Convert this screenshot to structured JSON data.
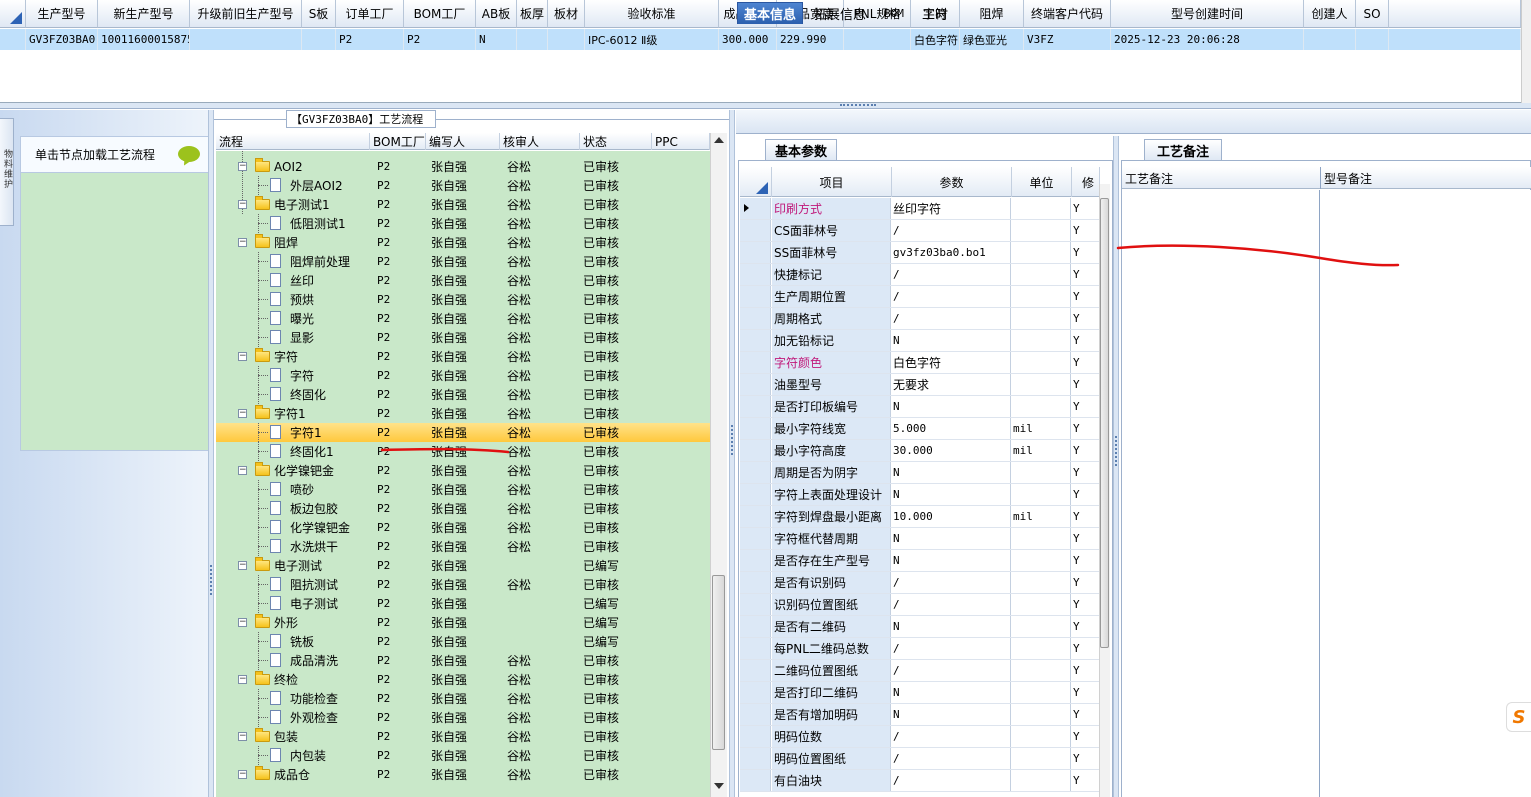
{
  "top_grid": {
    "columns": [
      "生产型号",
      "新生产型号",
      "升级前旧生产型号",
      "S板",
      "订单工厂",
      "BOM工厂",
      "AB板",
      "板厚",
      "板材",
      "验收标准",
      "成品长度",
      "成品宽度",
      "PNL规格",
      "字符",
      "阻焊",
      "终端客户代码",
      "型号创建时间",
      "创建人",
      "SO"
    ],
    "row": [
      "GV3FZ03BA0",
      "10011600015875",
      "",
      "",
      "P2",
      "P2",
      "N",
      "",
      "",
      "IPC-6012 Ⅱ级",
      "300.000",
      "229.990",
      "",
      "白色字符",
      "绿色亚光",
      "V3FZ",
      "2025-12-23 20:06:28",
      "",
      ""
    ]
  },
  "left_panel": {
    "side_tab": "物料维护",
    "hint": "单击节点加载工艺流程"
  },
  "process_panel": {
    "title": "【GV3FZ03BA0】工艺流程",
    "columns": [
      "流程",
      "BOM工厂",
      "编写人",
      "核审人",
      "状态",
      "PPC"
    ],
    "rows": [
      {
        "level": 1,
        "name": "AOI2",
        "bom": "P2",
        "writer": "张自强",
        "reviewer": "谷松",
        "status": "已审核"
      },
      {
        "level": 2,
        "name": "外层AOI2",
        "bom": "P2",
        "writer": "张自强",
        "reviewer": "谷松",
        "status": "已审核"
      },
      {
        "level": 1,
        "name": "电子测试1",
        "bom": "P2",
        "writer": "张自强",
        "reviewer": "谷松",
        "status": "已审核"
      },
      {
        "level": 2,
        "name": "低阻测试1",
        "bom": "P2",
        "writer": "张自强",
        "reviewer": "谷松",
        "status": "已审核"
      },
      {
        "level": 1,
        "name": "阻焊",
        "bom": "P2",
        "writer": "张自强",
        "reviewer": "谷松",
        "status": "已审核"
      },
      {
        "level": 2,
        "name": "阻焊前处理",
        "bom": "P2",
        "writer": "张自强",
        "reviewer": "谷松",
        "status": "已审核"
      },
      {
        "level": 2,
        "name": "丝印",
        "bom": "P2",
        "writer": "张自强",
        "reviewer": "谷松",
        "status": "已审核"
      },
      {
        "level": 2,
        "name": "预烘",
        "bom": "P2",
        "writer": "张自强",
        "reviewer": "谷松",
        "status": "已审核"
      },
      {
        "level": 2,
        "name": "曝光",
        "bom": "P2",
        "writer": "张自强",
        "reviewer": "谷松",
        "status": "已审核"
      },
      {
        "level": 2,
        "name": "显影",
        "bom": "P2",
        "writer": "张自强",
        "reviewer": "谷松",
        "status": "已审核"
      },
      {
        "level": 1,
        "name": "字符",
        "bom": "P2",
        "writer": "张自强",
        "reviewer": "谷松",
        "status": "已审核"
      },
      {
        "level": 2,
        "name": "字符",
        "bom": "P2",
        "writer": "张自强",
        "reviewer": "谷松",
        "status": "已审核"
      },
      {
        "level": 2,
        "name": "终固化",
        "bom": "P2",
        "writer": "张自强",
        "reviewer": "谷松",
        "status": "已审核"
      },
      {
        "level": 1,
        "name": "字符1",
        "bom": "P2",
        "writer": "张自强",
        "reviewer": "谷松",
        "status": "已审核"
      },
      {
        "level": 2,
        "name": "字符1",
        "bom": "P2",
        "writer": "张自强",
        "reviewer": "谷松",
        "status": "已审核",
        "selected": true
      },
      {
        "level": 2,
        "name": "终固化1",
        "bom": "P2",
        "writer": "张自强",
        "reviewer": "谷松",
        "status": "已审核"
      },
      {
        "level": 1,
        "name": "化学镍钯金",
        "bom": "P2",
        "writer": "张自强",
        "reviewer": "谷松",
        "status": "已审核"
      },
      {
        "level": 2,
        "name": "喷砂",
        "bom": "P2",
        "writer": "张自强",
        "reviewer": "谷松",
        "status": "已审核"
      },
      {
        "level": 2,
        "name": "板边包胶",
        "bom": "P2",
        "writer": "张自强",
        "reviewer": "谷松",
        "status": "已审核"
      },
      {
        "level": 2,
        "name": "化学镍钯金",
        "bom": "P2",
        "writer": "张自强",
        "reviewer": "谷松",
        "status": "已审核"
      },
      {
        "level": 2,
        "name": "水洗烘干",
        "bom": "P2",
        "writer": "张自强",
        "reviewer": "谷松",
        "status": "已审核"
      },
      {
        "level": 1,
        "name": "电子测试",
        "bom": "P2",
        "writer": "张自强",
        "reviewer": "",
        "status": "已编写"
      },
      {
        "level": 2,
        "name": "阻抗测试",
        "bom": "P2",
        "writer": "张自强",
        "reviewer": "谷松",
        "status": "已审核"
      },
      {
        "level": 2,
        "name": "电子测试",
        "bom": "P2",
        "writer": "张自强",
        "reviewer": "",
        "status": "已编写"
      },
      {
        "level": 1,
        "name": "外形",
        "bom": "P2",
        "writer": "张自强",
        "reviewer": "",
        "status": "已编写"
      },
      {
        "level": 2,
        "name": "铣板",
        "bom": "P2",
        "writer": "张自强",
        "reviewer": "",
        "status": "已编写"
      },
      {
        "level": 2,
        "name": "成品清洗",
        "bom": "P2",
        "writer": "张自强",
        "reviewer": "谷松",
        "status": "已审核"
      },
      {
        "level": 1,
        "name": "终检",
        "bom": "P2",
        "writer": "张自强",
        "reviewer": "谷松",
        "status": "已审核"
      },
      {
        "level": 2,
        "name": "功能检查",
        "bom": "P2",
        "writer": "张自强",
        "reviewer": "谷松",
        "status": "已审核"
      },
      {
        "level": 2,
        "name": "外观检查",
        "bom": "P2",
        "writer": "张自强",
        "reviewer": "谷松",
        "status": "已审核"
      },
      {
        "level": 1,
        "name": "包装",
        "bom": "P2",
        "writer": "张自强",
        "reviewer": "谷松",
        "status": "已审核"
      },
      {
        "level": 2,
        "name": "内包装",
        "bom": "P2",
        "writer": "张自强",
        "reviewer": "谷松",
        "status": "已审核"
      },
      {
        "level": 1,
        "name": "成品仓",
        "bom": "P2",
        "writer": "张自强",
        "reviewer": "谷松",
        "status": "已审核"
      }
    ]
  },
  "right_tabs": [
    "基本信息",
    "拓展信息",
    "BOM",
    "工时"
  ],
  "basic_params": {
    "tab": "基本参数",
    "columns": [
      "项目",
      "参数",
      "单位",
      "修"
    ],
    "rows": [
      {
        "item": "印刷方式",
        "value": "丝印字符",
        "unit": "",
        "flag": "Y",
        "pink": true,
        "current": true
      },
      {
        "item": "CS面菲林号",
        "value": "/",
        "unit": "",
        "flag": "Y"
      },
      {
        "item": "SS面菲林号",
        "value": "gv3fz03ba0.bo1",
        "unit": "",
        "flag": "Y"
      },
      {
        "item": "快捷标记",
        "value": "/",
        "unit": "",
        "flag": "Y"
      },
      {
        "item": "生产周期位置",
        "value": "/",
        "unit": "",
        "flag": "Y"
      },
      {
        "item": "周期格式",
        "value": "/",
        "unit": "",
        "flag": "Y"
      },
      {
        "item": "加无铅标记",
        "value": "N",
        "unit": "",
        "flag": "Y"
      },
      {
        "item": "字符颜色",
        "value": "白色字符",
        "unit": "",
        "flag": "Y",
        "pink": true
      },
      {
        "item": "油墨型号",
        "value": "无要求",
        "unit": "",
        "flag": "Y"
      },
      {
        "item": "是否打印板编号",
        "value": "N",
        "unit": "",
        "flag": "Y"
      },
      {
        "item": "最小字符线宽",
        "value": "5.000",
        "unit": "mil",
        "flag": "Y"
      },
      {
        "item": "最小字符高度",
        "value": "30.000",
        "unit": "mil",
        "flag": "Y"
      },
      {
        "item": "周期是否为阴字",
        "value": "N",
        "unit": "",
        "flag": "Y"
      },
      {
        "item": "字符上表面处理设计",
        "value": "N",
        "unit": "",
        "flag": "Y"
      },
      {
        "item": "字符到焊盘最小距离",
        "value": "10.000",
        "unit": "mil",
        "flag": "Y"
      },
      {
        "item": "字符框代替周期",
        "value": "N",
        "unit": "",
        "flag": "Y"
      },
      {
        "item": "是否存在生产型号",
        "value": "N",
        "unit": "",
        "flag": "Y"
      },
      {
        "item": "是否有识别码",
        "value": "/",
        "unit": "",
        "flag": "Y"
      },
      {
        "item": "识别码位置图纸",
        "value": "/",
        "unit": "",
        "flag": "Y"
      },
      {
        "item": "是否有二维码",
        "value": "N",
        "unit": "",
        "flag": "Y"
      },
      {
        "item": "每PNL二维码总数",
        "value": "/",
        "unit": "",
        "flag": "Y"
      },
      {
        "item": "二维码位置图纸",
        "value": "/",
        "unit": "",
        "flag": "Y"
      },
      {
        "item": "是否打印二维码",
        "value": "N",
        "unit": "",
        "flag": "Y"
      },
      {
        "item": "是否有增加明码",
        "value": "N",
        "unit": "",
        "flag": "Y"
      },
      {
        "item": "明码位数",
        "value": "/",
        "unit": "",
        "flag": "Y"
      },
      {
        "item": "明码位置图纸",
        "value": "/",
        "unit": "",
        "flag": "Y"
      },
      {
        "item": "有白油块",
        "value": "/",
        "unit": "",
        "flag": "Y"
      }
    ]
  },
  "process_notes": {
    "tab": "工艺备注",
    "columns": [
      "工艺备注",
      "型号备注"
    ]
  },
  "colors": {
    "selection_blue": "#bfe0fb",
    "tree_green": "#c9e8c9",
    "selected_row": "#ffc83d",
    "pink_text": "#c0187a",
    "annotation_red": "#e01010"
  }
}
